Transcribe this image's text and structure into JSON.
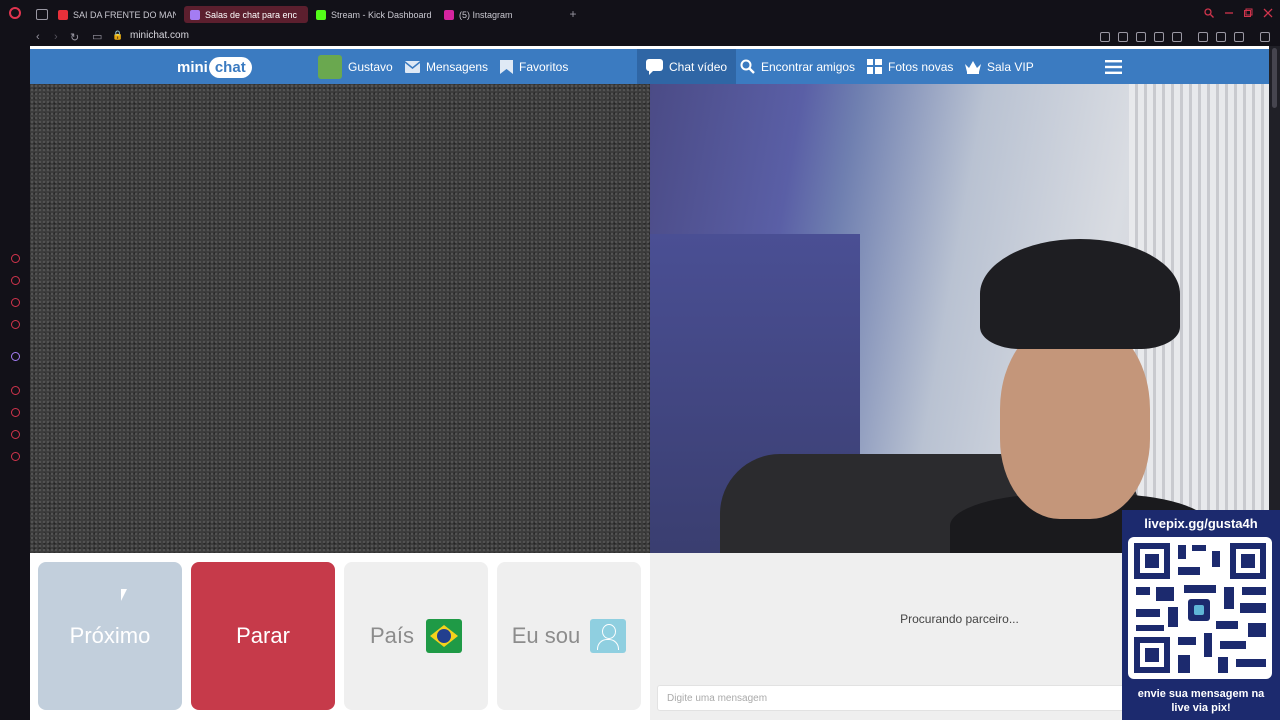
{
  "browser": {
    "tabs": [
      {
        "label": "SAI DA FRENTE DO MANO",
        "fav_color": "#e8303a"
      },
      {
        "label": "Salas de chat para enc",
        "fav_color": "#a47cf3"
      },
      {
        "label": "Stream - Kick Dashboard",
        "fav_color": "#53fc18"
      },
      {
        "label": "(5) Instagram",
        "fav_color": "#d6249f"
      }
    ],
    "url": "minichat.com"
  },
  "site": {
    "logo_prefix": "mini",
    "logo_suffix": "chat",
    "nav": {
      "user": "Gustavo",
      "messages": "Mensagens",
      "favorites": "Favoritos",
      "video_chat": "Chat vídeo",
      "find_friends": "Encontrar amigos",
      "new_photos": "Fotos novas",
      "vip_room": "Sala VIP"
    },
    "controls": {
      "next": "Próximo",
      "stop": "Parar",
      "country": "País",
      "iam": "Eu sou"
    },
    "chat": {
      "status": "Procurando parceiro...",
      "placeholder": "Digite uma mensagem"
    }
  },
  "overlay": {
    "top": "livepix.gg/gusta4h",
    "bottom_line1": "envie sua mensagem na",
    "bottom_line2": "live via pix!"
  },
  "colors": {
    "nav_blue": "#3b7bc1",
    "stop_red": "#c63a4a",
    "next_blue": "#c2cfdc",
    "overlay_navy": "#1c2a6e"
  }
}
